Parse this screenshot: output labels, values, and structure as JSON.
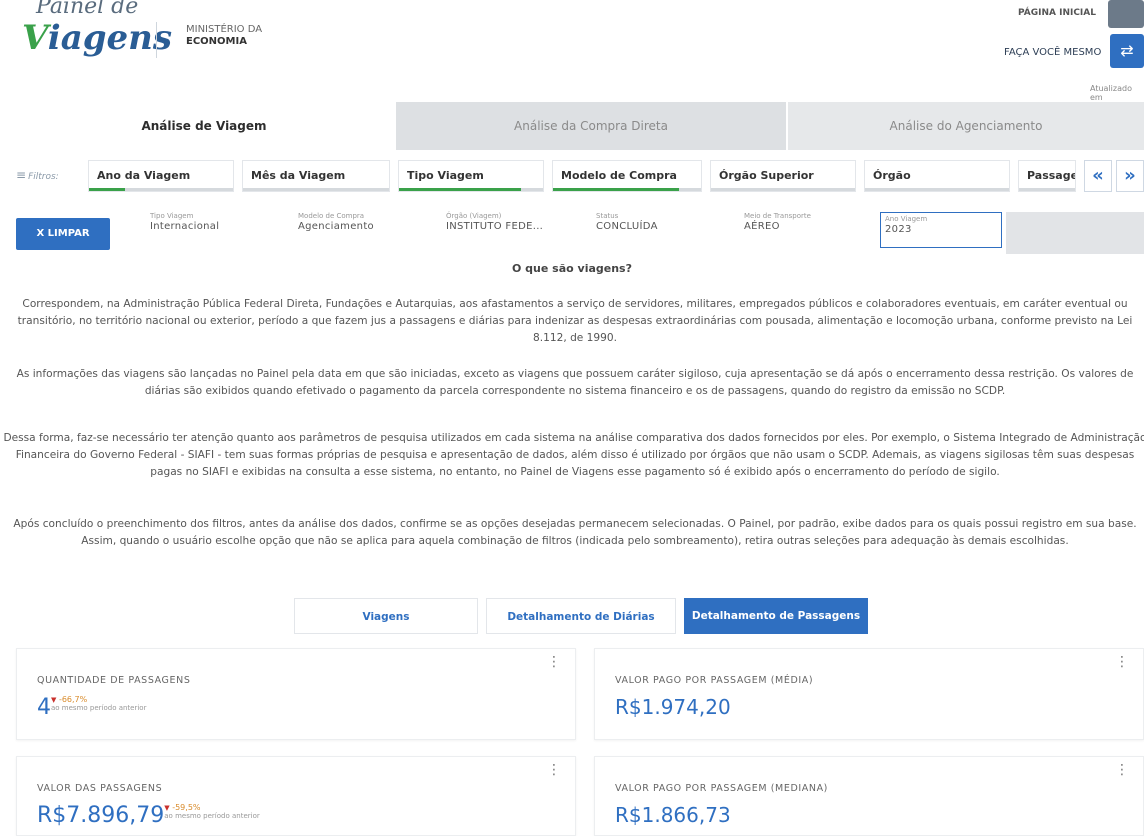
{
  "header": {
    "logo_top": "Painel de",
    "logo_main_v": "V",
    "logo_main_rest": "iagens",
    "ministry_line1": "MINISTÉRIO DA",
    "ministry_line2": "ECONOMIA",
    "pagina_inicial": "PÁGINA INICIAL",
    "faca_voce_mesmo": "FAÇA VOCÊ MESMO",
    "atualizado": "Atualizado em"
  },
  "tabs": [
    {
      "label": "Análise de Viagem"
    },
    {
      "label": "Análise da Compra Direta"
    },
    {
      "label": "Análise do Agenciamento"
    }
  ],
  "filters": {
    "label": "Filtros:",
    "items": [
      {
        "label": "Ano da Viagem",
        "fill": 0.25
      },
      {
        "label": "Mês da Viagem",
        "fill": 0.0
      },
      {
        "label": "Tipo Viagem",
        "fill": 0.85
      },
      {
        "label": "Modelo de Compra",
        "fill": 0.85
      },
      {
        "label": "Órgão Superior",
        "fill": 0.0
      },
      {
        "label": "Órgão",
        "fill": 0.0
      },
      {
        "label": "Passage",
        "fill": 0.0
      }
    ],
    "prev": "«",
    "next": "»"
  },
  "selections": {
    "clear_label": "X LIMPAR",
    "items": [
      {
        "key": "Tipo Viagem",
        "value": "Internacional"
      },
      {
        "key": "Modelo de Compra",
        "value": "Agenciamento"
      },
      {
        "key": "Órgão (Viagem)",
        "value": "INSTITUTO FEDE..."
      },
      {
        "key": "Status",
        "value": "CONCLUÍDA"
      },
      {
        "key": "Meio de Transporte",
        "value": "AÉREO"
      },
      {
        "key": "Ano Viagem",
        "value": "2023"
      }
    ]
  },
  "info": {
    "title": "O que são viagens?",
    "p1": "Correspondem, na Administração Pública Federal Direta, Fundações e Autarquias, aos afastamentos a serviço de servidores, militares, empregados públicos e colaboradores eventuais, em caráter eventual ou transitório, no território nacional ou exterior, período a que fazem jus a passagens e diárias para indenizar as despesas extraordinárias com pousada, alimentação e locomoção urbana, conforme previsto na Lei 8.112, de 1990.",
    "p2": "As informações das viagens são lançadas no Painel pela data em que são iniciadas, exceto as viagens que possuem caráter sigiloso, cuja apresentação se dá após o encerramento dessa restrição. Os valores de diárias são exibidos quando efetivado o pagamento da parcela correspondente no sistema financeiro e os de passagens, quando do registro da emissão no SCDP.",
    "p3": "Dessa forma, faz-se necessário ter atenção quanto aos parâmetros de pesquisa utilizados em cada sistema na análise comparativa dos dados fornecidos por eles. Por exemplo, o Sistema Integrado de Administração Financeira do Governo Federal - SIAFI - tem suas formas próprias de pesquisa e apresentação de dados, além disso é utilizado por órgãos que não usam o SCDP. Ademais, as viagens sigilosas têm suas despesas pagas no SIAFI e exibidas na consulta a esse sistema, no entanto, no Painel de Viagens esse pagamento só é exibido após o encerramento do período de sigilo.",
    "p4": "Após concluído o preenchimento dos filtros, antes da análise dos dados, confirme se as opções desejadas permanecem selecionadas. O Painel, por padrão, exibe dados para os quais possui registro em sua base. Assim, quando o usuário escolhe opção que não se aplica para aquela combinação de filtros (indicada pelo sombreamento), retira outras seleções para adequação às demais escolhidas."
  },
  "view_tabs": [
    {
      "label": "Viagens"
    },
    {
      "label": "Detalhamento de Diárias"
    },
    {
      "label": "Detalhamento de Passagens"
    }
  ],
  "cards": {
    "qtd": {
      "label": "QUANTIDADE DE PASSAGENS",
      "value": "4",
      "delta": "-66,7%",
      "delta_sub": "ao mesmo período anterior"
    },
    "media": {
      "label": "VALOR PAGO POR PASSAGEM (MÉDIA)",
      "value": "R$1.974,20"
    },
    "valor": {
      "label": "VALOR DAS PASSAGENS",
      "value": "R$7.896,79",
      "delta": "-59,5%",
      "delta_sub": "ao mesmo período anterior"
    },
    "mediana": {
      "label": "VALOR PAGO POR PASSAGEM (MEDIANA)",
      "value": "R$1.866,73"
    }
  },
  "icons": {
    "filter": "≡",
    "kebab": "⋮",
    "settings": "⇄",
    "down_triangle": "▼"
  },
  "colors": {
    "primary": "#2f6fc1",
    "green": "#3aa14a",
    "delta_orange": "#d98b2b",
    "delta_red": "#c9302c"
  }
}
